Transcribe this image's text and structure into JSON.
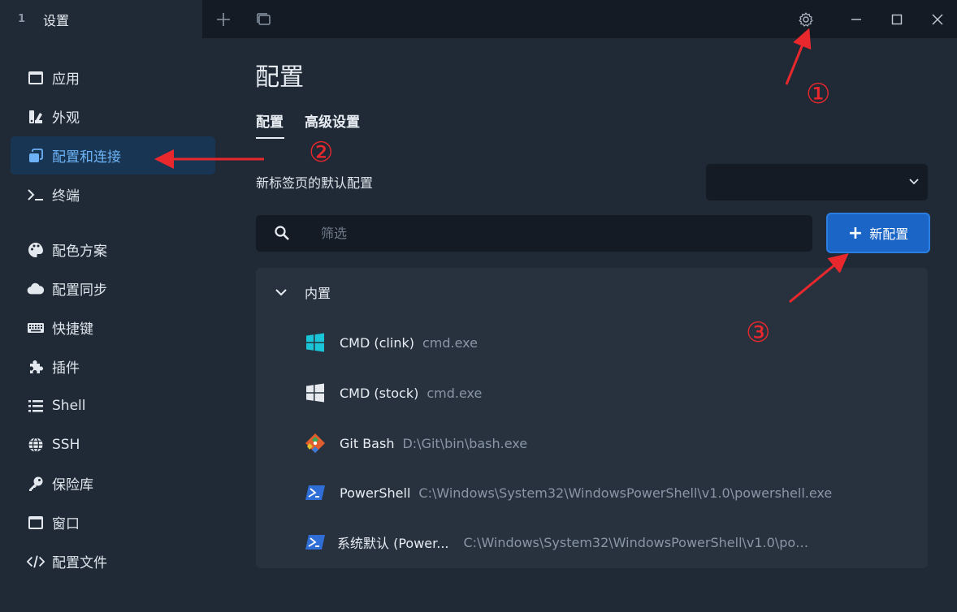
{
  "titlebar": {
    "tab_number": "1",
    "tab_title": "设置"
  },
  "sidebar": {
    "items": [
      {
        "label": "应用",
        "icon": "window-icon"
      },
      {
        "label": "外观",
        "icon": "brush-icon"
      },
      {
        "label": "配置和连接",
        "icon": "profiles-icon"
      },
      {
        "label": "终端",
        "icon": "terminal-icon"
      },
      {
        "label": "配色方案",
        "icon": "palette-icon"
      },
      {
        "label": "配置同步",
        "icon": "cloud-icon"
      },
      {
        "label": "快捷键",
        "icon": "keyboard-icon"
      },
      {
        "label": "插件",
        "icon": "puzzle-icon"
      },
      {
        "label": "Shell",
        "icon": "list-icon"
      },
      {
        "label": "SSH",
        "icon": "globe-icon"
      },
      {
        "label": "保险库",
        "icon": "key-icon"
      },
      {
        "label": "窗口",
        "icon": "window-icon"
      },
      {
        "label": "配置文件",
        "icon": "code-icon"
      }
    ],
    "active_index": 2
  },
  "main": {
    "title": "配置",
    "tabs": [
      {
        "label": "配置",
        "active": true
      },
      {
        "label": "高级设置",
        "active": false
      }
    ],
    "default_profile_label": "新标签页的默认配置",
    "default_profile_value": "",
    "filter_placeholder": "筛选",
    "new_profile_label": "新配置",
    "group": {
      "label": "内置",
      "profiles": [
        {
          "name": "CMD (clink)",
          "command": "cmd.exe",
          "icon": "windows-icon",
          "color": "#19c5d6"
        },
        {
          "name": "CMD (stock)",
          "command": "cmd.exe",
          "icon": "windows-icon",
          "color": "#e6eaee"
        },
        {
          "name": "Git Bash",
          "command": "D:\\Git\\bin\\bash.exe",
          "icon": "git-icon",
          "color": "#e05d2e"
        },
        {
          "name": "PowerShell",
          "command": "C:\\Windows\\System32\\WindowsPowerShell\\v1.0\\powershell.exe",
          "icon": "powershell-icon",
          "color": "#2f6ed6"
        },
        {
          "name": "系统默认 (Power...",
          "command": "C:\\Windows\\System32\\WindowsPowerShell\\v1.0\\power...",
          "icon": "powershell-icon",
          "color": "#2f6ed6"
        }
      ]
    }
  },
  "annotations": {
    "one": "①",
    "two": "②",
    "three": "③",
    "color": "#e8282c"
  }
}
